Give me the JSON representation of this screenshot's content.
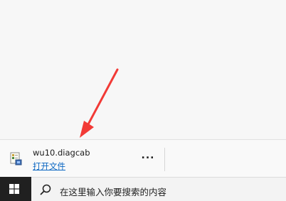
{
  "download": {
    "file_name": "wu10.diagcab",
    "open_label": "打开文件",
    "more_label": "...",
    "file_icon": "diagcab-file-icon"
  },
  "annotation": {
    "arrow_color": "#ff3b3b"
  },
  "taskbar": {
    "start_icon": "windows-logo-icon",
    "search_icon": "search-icon",
    "search_placeholder": "在这里输入你要搜索的内容"
  }
}
